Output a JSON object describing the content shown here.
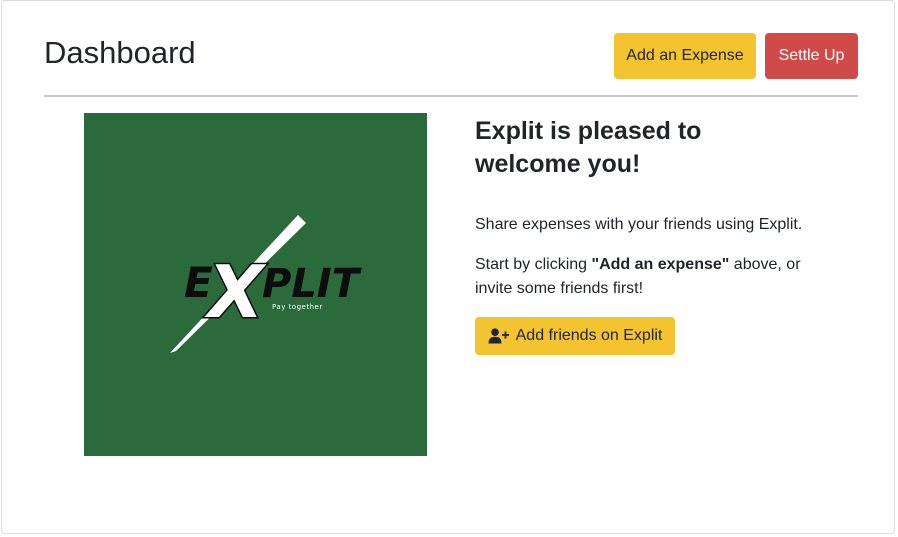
{
  "header": {
    "title": "Dashboard",
    "add_expense_label": "Add an Expense",
    "settle_up_label": "Settle Up"
  },
  "logo": {
    "letters_before_x": "E",
    "letter_x": "X",
    "letters_after_x": "PLIT",
    "tagline": "Pay together",
    "background": "#2b6a3b"
  },
  "welcome": {
    "title": "Explit is pleased to welcome you!",
    "line1": "Share expenses with your friends using Explit.",
    "line2_prefix": "Start by clicking ",
    "line2_bold": "\"Add an expense\"",
    "line2_suffix": " above, or invite some friends first!",
    "add_friends_label": "Add friends on Explit",
    "add_friends_icon": "user-plus-icon"
  },
  "colors": {
    "primary_yellow": "#f4c430",
    "danger_red": "#d04a4a"
  }
}
